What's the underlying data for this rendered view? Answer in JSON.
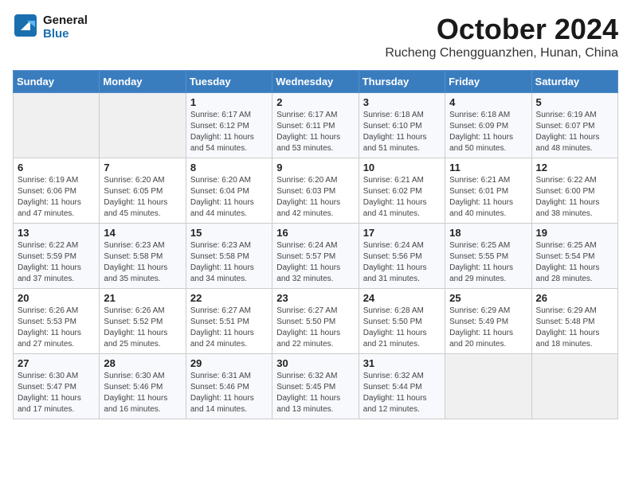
{
  "header": {
    "logo_general": "General",
    "logo_blue": "Blue",
    "month_title": "October 2024",
    "location": "Rucheng Chengguanzhen, Hunan, China"
  },
  "days_of_week": [
    "Sunday",
    "Monday",
    "Tuesday",
    "Wednesday",
    "Thursday",
    "Friday",
    "Saturday"
  ],
  "weeks": [
    [
      {
        "day": "",
        "info": ""
      },
      {
        "day": "",
        "info": ""
      },
      {
        "day": "1",
        "info": "Sunrise: 6:17 AM\nSunset: 6:12 PM\nDaylight: 11 hours and 54 minutes."
      },
      {
        "day": "2",
        "info": "Sunrise: 6:17 AM\nSunset: 6:11 PM\nDaylight: 11 hours and 53 minutes."
      },
      {
        "day": "3",
        "info": "Sunrise: 6:18 AM\nSunset: 6:10 PM\nDaylight: 11 hours and 51 minutes."
      },
      {
        "day": "4",
        "info": "Sunrise: 6:18 AM\nSunset: 6:09 PM\nDaylight: 11 hours and 50 minutes."
      },
      {
        "day": "5",
        "info": "Sunrise: 6:19 AM\nSunset: 6:07 PM\nDaylight: 11 hours and 48 minutes."
      }
    ],
    [
      {
        "day": "6",
        "info": "Sunrise: 6:19 AM\nSunset: 6:06 PM\nDaylight: 11 hours and 47 minutes."
      },
      {
        "day": "7",
        "info": "Sunrise: 6:20 AM\nSunset: 6:05 PM\nDaylight: 11 hours and 45 minutes."
      },
      {
        "day": "8",
        "info": "Sunrise: 6:20 AM\nSunset: 6:04 PM\nDaylight: 11 hours and 44 minutes."
      },
      {
        "day": "9",
        "info": "Sunrise: 6:20 AM\nSunset: 6:03 PM\nDaylight: 11 hours and 42 minutes."
      },
      {
        "day": "10",
        "info": "Sunrise: 6:21 AM\nSunset: 6:02 PM\nDaylight: 11 hours and 41 minutes."
      },
      {
        "day": "11",
        "info": "Sunrise: 6:21 AM\nSunset: 6:01 PM\nDaylight: 11 hours and 40 minutes."
      },
      {
        "day": "12",
        "info": "Sunrise: 6:22 AM\nSunset: 6:00 PM\nDaylight: 11 hours and 38 minutes."
      }
    ],
    [
      {
        "day": "13",
        "info": "Sunrise: 6:22 AM\nSunset: 5:59 PM\nDaylight: 11 hours and 37 minutes."
      },
      {
        "day": "14",
        "info": "Sunrise: 6:23 AM\nSunset: 5:58 PM\nDaylight: 11 hours and 35 minutes."
      },
      {
        "day": "15",
        "info": "Sunrise: 6:23 AM\nSunset: 5:58 PM\nDaylight: 11 hours and 34 minutes."
      },
      {
        "day": "16",
        "info": "Sunrise: 6:24 AM\nSunset: 5:57 PM\nDaylight: 11 hours and 32 minutes."
      },
      {
        "day": "17",
        "info": "Sunrise: 6:24 AM\nSunset: 5:56 PM\nDaylight: 11 hours and 31 minutes."
      },
      {
        "day": "18",
        "info": "Sunrise: 6:25 AM\nSunset: 5:55 PM\nDaylight: 11 hours and 29 minutes."
      },
      {
        "day": "19",
        "info": "Sunrise: 6:25 AM\nSunset: 5:54 PM\nDaylight: 11 hours and 28 minutes."
      }
    ],
    [
      {
        "day": "20",
        "info": "Sunrise: 6:26 AM\nSunset: 5:53 PM\nDaylight: 11 hours and 27 minutes."
      },
      {
        "day": "21",
        "info": "Sunrise: 6:26 AM\nSunset: 5:52 PM\nDaylight: 11 hours and 25 minutes."
      },
      {
        "day": "22",
        "info": "Sunrise: 6:27 AM\nSunset: 5:51 PM\nDaylight: 11 hours and 24 minutes."
      },
      {
        "day": "23",
        "info": "Sunrise: 6:27 AM\nSunset: 5:50 PM\nDaylight: 11 hours and 22 minutes."
      },
      {
        "day": "24",
        "info": "Sunrise: 6:28 AM\nSunset: 5:50 PM\nDaylight: 11 hours and 21 minutes."
      },
      {
        "day": "25",
        "info": "Sunrise: 6:29 AM\nSunset: 5:49 PM\nDaylight: 11 hours and 20 minutes."
      },
      {
        "day": "26",
        "info": "Sunrise: 6:29 AM\nSunset: 5:48 PM\nDaylight: 11 hours and 18 minutes."
      }
    ],
    [
      {
        "day": "27",
        "info": "Sunrise: 6:30 AM\nSunset: 5:47 PM\nDaylight: 11 hours and 17 minutes."
      },
      {
        "day": "28",
        "info": "Sunrise: 6:30 AM\nSunset: 5:46 PM\nDaylight: 11 hours and 16 minutes."
      },
      {
        "day": "29",
        "info": "Sunrise: 6:31 AM\nSunset: 5:46 PM\nDaylight: 11 hours and 14 minutes."
      },
      {
        "day": "30",
        "info": "Sunrise: 6:32 AM\nSunset: 5:45 PM\nDaylight: 11 hours and 13 minutes."
      },
      {
        "day": "31",
        "info": "Sunrise: 6:32 AM\nSunset: 5:44 PM\nDaylight: 11 hours and 12 minutes."
      },
      {
        "day": "",
        "info": ""
      },
      {
        "day": "",
        "info": ""
      }
    ]
  ]
}
